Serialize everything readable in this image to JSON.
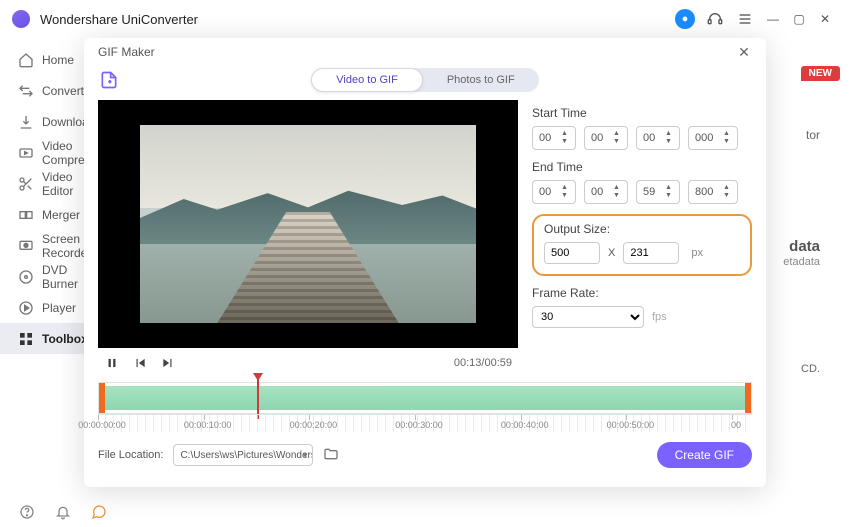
{
  "app": {
    "title": "Wondershare UniConverter"
  },
  "sidebar": {
    "items": [
      {
        "label": "Home"
      },
      {
        "label": "Converter"
      },
      {
        "label": "Download"
      },
      {
        "label": "Video Compressor"
      },
      {
        "label": "Video Editor"
      },
      {
        "label": "Merger"
      },
      {
        "label": "Screen Recorder"
      },
      {
        "label": "DVD Burner"
      },
      {
        "label": "Player"
      },
      {
        "label": "Toolbox"
      }
    ]
  },
  "bg": {
    "new_badge": "NEW",
    "tor": "tor",
    "data": "data",
    "etadata": "etadata",
    "cd": "CD."
  },
  "modal": {
    "title": "GIF Maker",
    "tabs": {
      "video": "Video to GIF",
      "photos": "Photos to GIF"
    },
    "player": {
      "time": "00:13/00:59"
    },
    "settings": {
      "start_label": "Start Time",
      "end_label": "End Time",
      "start": {
        "h": "00",
        "m": "00",
        "s": "00",
        "ms": "000"
      },
      "end": {
        "h": "00",
        "m": "00",
        "s": "59",
        "ms": "800"
      },
      "size_label": "Output Size:",
      "size": {
        "w": "500",
        "h": "231",
        "x": "X",
        "px": "px"
      },
      "frame_label": "Frame Rate:",
      "frame": {
        "value": "30",
        "unit": "fps"
      }
    },
    "timeline": {
      "ticks": [
        "00:00:00:00",
        "00:00:10:00",
        "00:00:20:00",
        "00:00:30:00",
        "00:00:40:00",
        "00:00:50:00",
        "00"
      ]
    },
    "footer": {
      "label": "File Location:",
      "path": "C:\\Users\\ws\\Pictures\\Wonders",
      "create": "Create GIF"
    }
  }
}
